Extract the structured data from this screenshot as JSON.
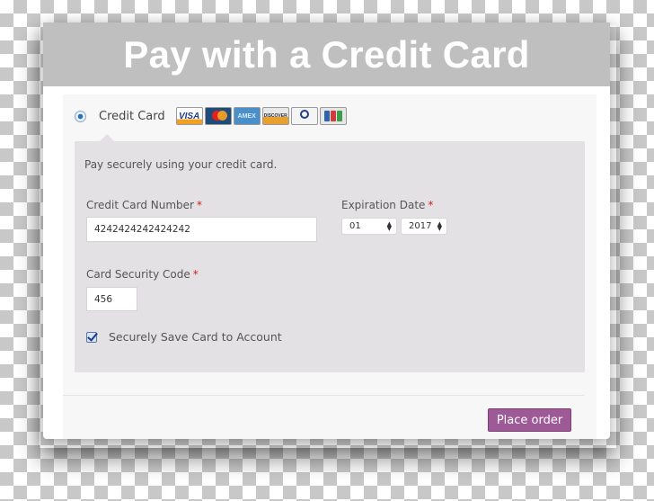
{
  "header": {
    "title": "Pay with a Credit Card"
  },
  "payment_method": {
    "label": "Credit Card",
    "selected": true,
    "cards": [
      {
        "name": "visa",
        "text": "VISA"
      },
      {
        "name": "mastercard",
        "text": ""
      },
      {
        "name": "amex",
        "text": "AMEX"
      },
      {
        "name": "discover",
        "text": "DISCOVER"
      },
      {
        "name": "diners-club",
        "text": ""
      },
      {
        "name": "jcb",
        "text": ""
      }
    ]
  },
  "form": {
    "description": "Pay securely using your credit card.",
    "card_number": {
      "label": "Credit Card Number",
      "required_mark": "*",
      "value": "4242424242424242"
    },
    "expiration": {
      "label": "Expiration Date",
      "required_mark": "*",
      "month": "01",
      "year": "2017"
    },
    "security_code": {
      "label": "Card Security Code",
      "required_mark": "*",
      "value": "456"
    },
    "save_card": {
      "label": "Securely Save Card to Account",
      "checked": true
    }
  },
  "actions": {
    "place_order": "Place order"
  },
  "colors": {
    "accent": "#9e5a96",
    "header_bg": "#bfbfbf",
    "required": "#d21f1f"
  }
}
